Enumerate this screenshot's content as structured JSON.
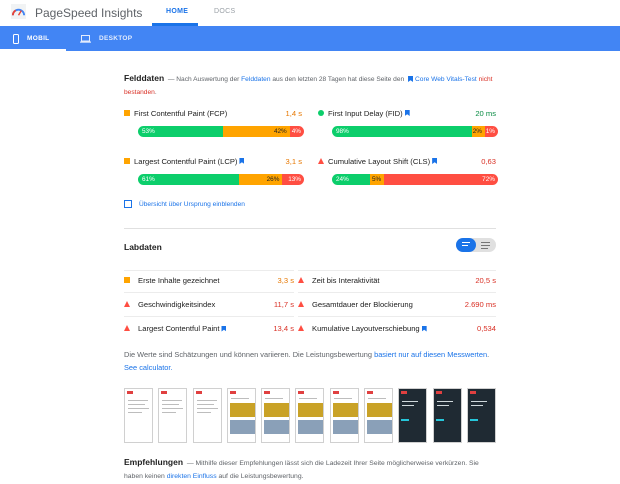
{
  "header": {
    "app_title": "PageSpeed Insights",
    "nav": [
      {
        "label": "HOME",
        "active": true
      },
      {
        "label": "DOCS",
        "active": false
      }
    ]
  },
  "device_tabs": [
    {
      "label": "MOBIL",
      "active": true
    },
    {
      "label": "DESKTOP",
      "active": false
    }
  ],
  "field": {
    "title": "Felddaten",
    "intro": {
      "dash": "—",
      "part1": "Nach Auswertung der",
      "link1": "Felddaten",
      "part2": "aus den letzten 28 Tagen hat diese Seite den",
      "link2": "Core Web Vitals-Test",
      "fail": "nicht bestanden",
      "end": "."
    },
    "metrics": [
      {
        "label": "First Contentful Paint (FCP)",
        "value": "1,4 s",
        "status": "average",
        "bookmark": false,
        "dist": [
          53,
          42,
          4
        ],
        "dist_labels": [
          "53%",
          "42%",
          "4%"
        ]
      },
      {
        "label": "First Input Delay (FID)",
        "value": "20 ms",
        "status": "good",
        "bookmark": true,
        "dist": [
          98,
          2,
          1
        ],
        "dist_labels": [
          "98%",
          "2%",
          "1%"
        ]
      },
      {
        "label": "Largest Contentful Paint (LCP)",
        "value": "3,1 s",
        "status": "average",
        "bookmark": true,
        "dist": [
          61,
          26,
          13
        ],
        "dist_labels": [
          "61%",
          "26%",
          "13%"
        ]
      },
      {
        "label": "Cumulative Layout Shift (CLS)",
        "value": "0,63",
        "status": "poor",
        "bookmark": true,
        "dist": [
          24,
          5,
          72
        ],
        "dist_labels": [
          "24%",
          "5%",
          "72%"
        ]
      }
    ],
    "origin_label": "Übersicht über Ursprung einblenden"
  },
  "lab": {
    "title": "Labdaten",
    "metrics": [
      {
        "label": "Erste Inhalte gezeichnet",
        "value": "3,3 s",
        "status": "average",
        "bookmark": false
      },
      {
        "label": "Zeit bis Interaktivität",
        "value": "20,5 s",
        "status": "poor",
        "bookmark": false
      },
      {
        "label": "Geschwindigkeitsindex",
        "value": "11,7 s",
        "status": "poor",
        "bookmark": false
      },
      {
        "label": "Gesamtdauer der Blockierung",
        "value": "2.690 ms",
        "status": "poor",
        "bookmark": false
      },
      {
        "label": "Largest Contentful Paint",
        "value": "13,4 s",
        "status": "poor",
        "bookmark": true
      },
      {
        "label": "Kumulative Layoutverschiebung",
        "value": "0,534",
        "status": "poor",
        "bookmark": true
      }
    ],
    "note": {
      "text": "Die Werte sind Schätzungen und können variieren. Die Leistungsbewertung",
      "link1": "basiert nur auf diesen Messwerten",
      "sep": ".",
      "link2": "See calculator."
    }
  },
  "filmstrip": {
    "frames": [
      "blank",
      "blank",
      "blank",
      "image",
      "image",
      "image",
      "image",
      "image",
      "dark",
      "dark",
      "dark"
    ]
  },
  "recommendations": {
    "title": "Empfehlungen",
    "dash": "—",
    "text1": "Mithilfe dieser Empfehlungen lässt sich die Ladezeit Ihrer Seite möglicherweise verkürzen. Sie haben keinen",
    "link": "direkten Einfluss",
    "text2": "auf die Leistungsbewertung."
  },
  "colors": {
    "blue": "#4285f4",
    "accent": "#1a73e8",
    "good": "#0cce6b",
    "average": "#ffa400",
    "poor": "#ff4e42"
  }
}
